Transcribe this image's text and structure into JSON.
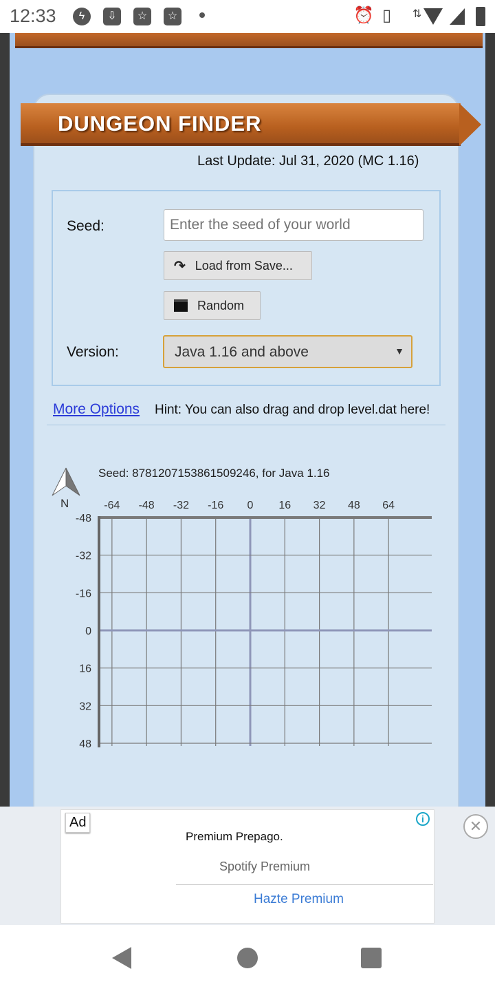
{
  "status_bar": {
    "time": "12:33",
    "icons": [
      "messenger-icon",
      "download-icon",
      "star-app-icon",
      "star-app-icon",
      "dot-icon",
      "alarm-icon",
      "vibrate-icon",
      "data-arrows-icon",
      "wifi-icon",
      "signal-icon",
      "battery-icon"
    ]
  },
  "header": {
    "title": "DUNGEON FINDER",
    "last_update": "Last Update: Jul 31, 2020 (MC 1.16)"
  },
  "form": {
    "seed_label": "Seed:",
    "seed_placeholder": "Enter the seed of your world",
    "seed_value": "",
    "load_label": "Load from Save...",
    "random_label": "Random",
    "version_label": "Version:",
    "version_value": "Java 1.16 and above"
  },
  "more_options": "More Options",
  "hint": "Hint: You can also drag and drop level.dat here!",
  "map": {
    "seed_info": "Seed: 8781207153861509246, for Java 1.16",
    "north_label": "N"
  },
  "chart_data": {
    "type": "grid-map",
    "x_ticks": [
      -64,
      -48,
      -32,
      -16,
      0,
      16,
      32,
      48,
      64
    ],
    "y_ticks": [
      -48,
      -32,
      -16,
      0,
      16,
      32,
      48
    ],
    "xlim": [
      -70,
      84
    ],
    "ylim": [
      -48,
      48
    ],
    "grid": true,
    "points": []
  },
  "ad": {
    "tag": "Ad",
    "headline": "Premium Prepago.",
    "advertiser": "Spotify Premium",
    "cta": "Hazte Premium",
    "info_color": "#1aa6c8",
    "cta_color": "#3a7bd5"
  },
  "colors": {
    "wood": "#b8601f",
    "background": "#a9c9ef",
    "panel": "#d5e5f3",
    "select_border": "#d6a13a",
    "link": "#2a3ad8"
  }
}
